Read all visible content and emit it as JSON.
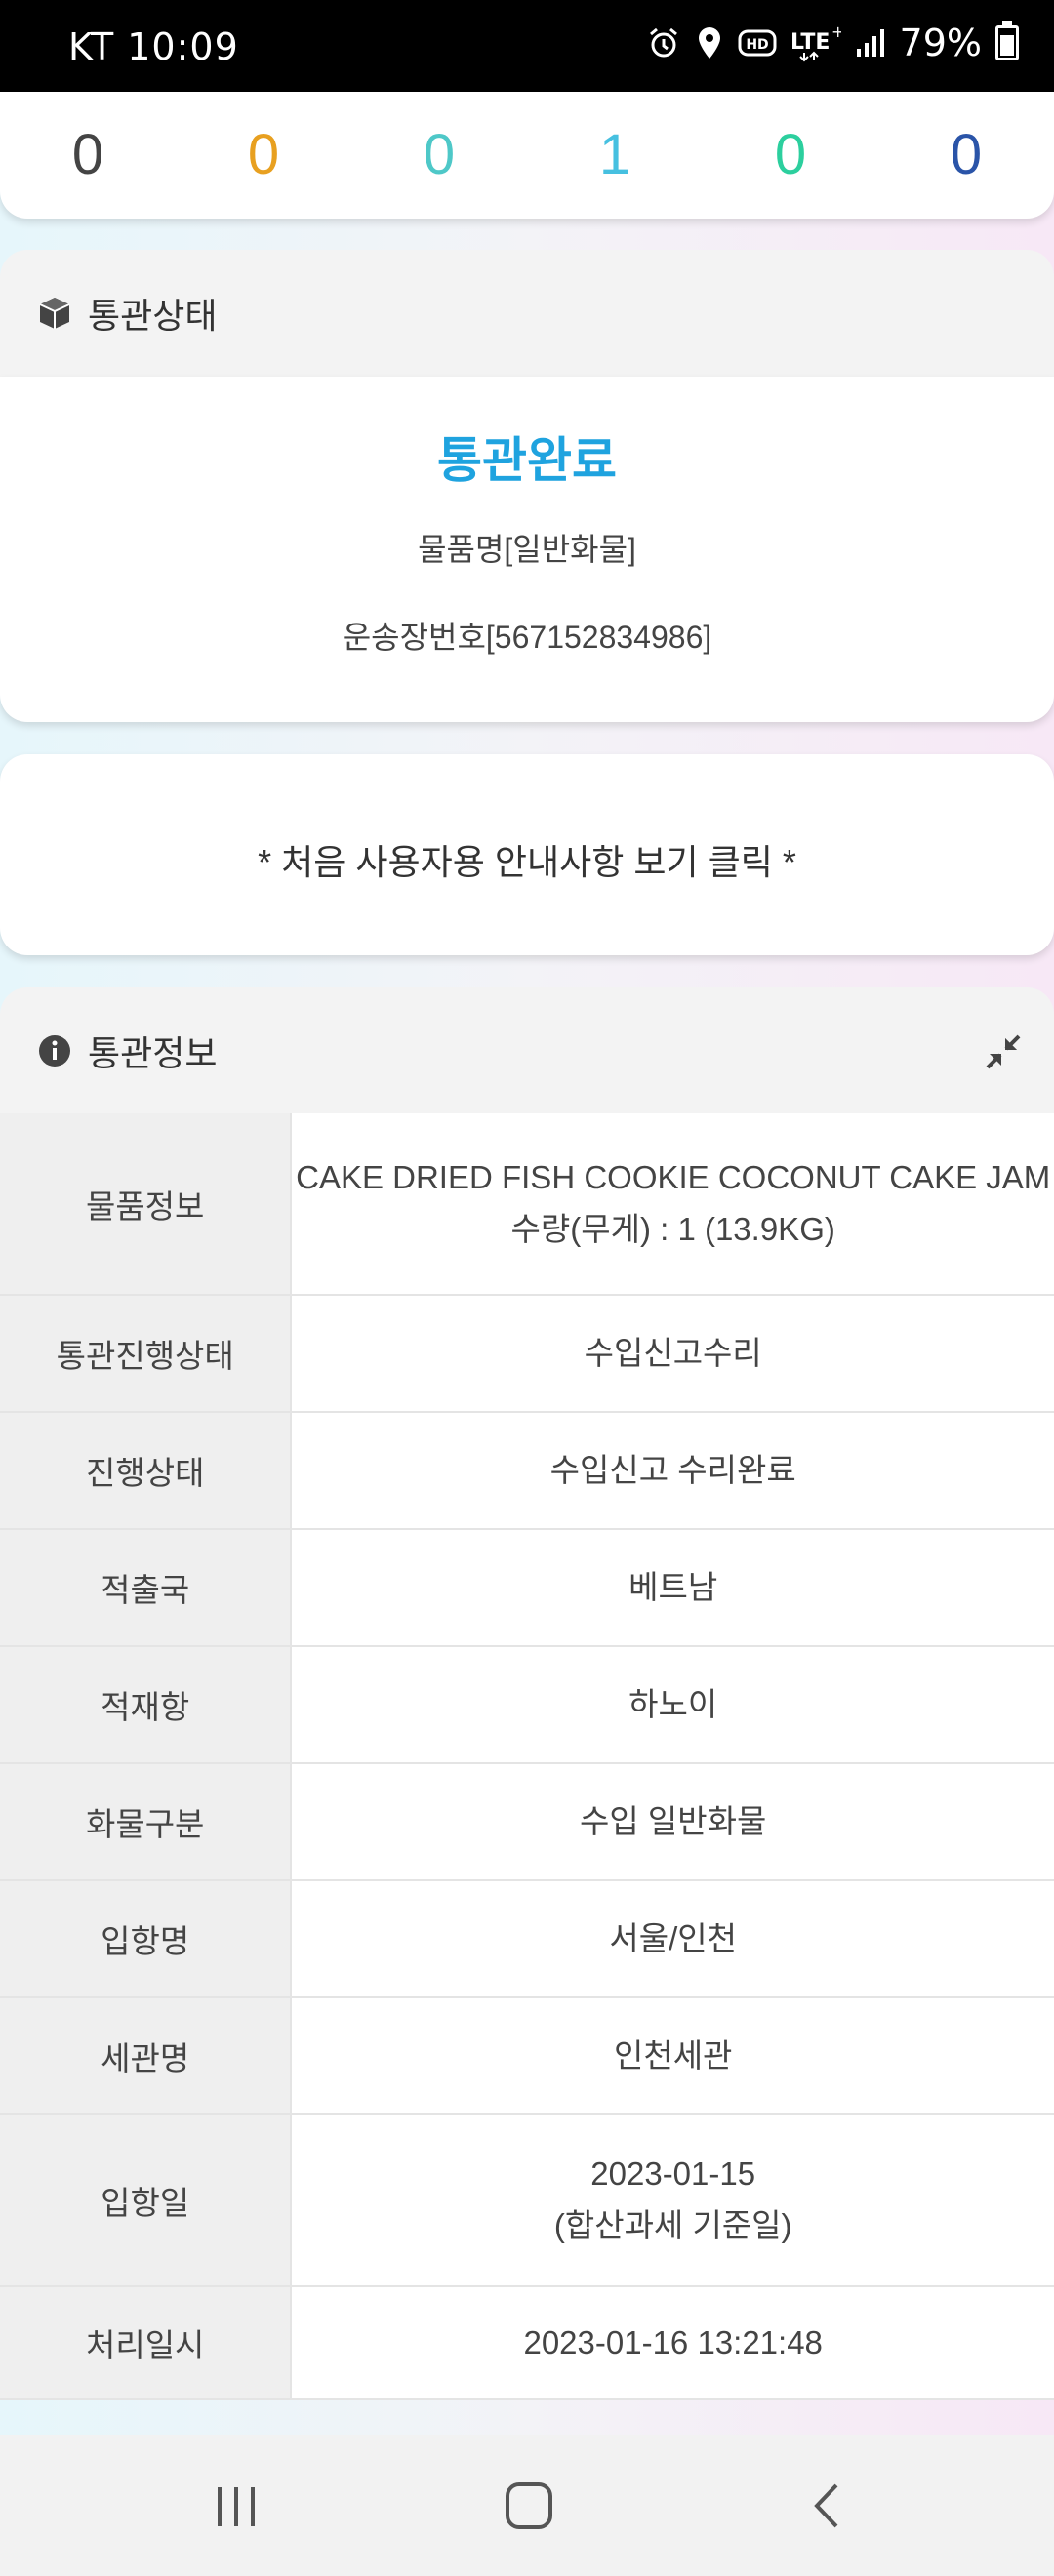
{
  "status_bar": {
    "carrier_time": "KT  10:09",
    "battery": "79%",
    "icons": [
      "alarm-icon",
      "location-icon",
      "hd-icon",
      "lte-icon",
      "signal-icon",
      "battery-icon"
    ]
  },
  "counters": [
    {
      "value": "0",
      "color": "#444444"
    },
    {
      "value": "0",
      "color": "#e8a020"
    },
    {
      "value": "0",
      "color": "#4ec8c8"
    },
    {
      "value": "1",
      "color": "#46c0e0"
    },
    {
      "value": "0",
      "color": "#2ccf9e"
    },
    {
      "value": "0",
      "color": "#2a54a8"
    }
  ],
  "customs_status": {
    "header": "통관상태",
    "header_icon": "box-icon",
    "main_status": "통관완료",
    "item_name": "물품명[일반화물]",
    "waybill": "운송장번호[567152834986]"
  },
  "guide": {
    "text": "* 처음 사용자용 안내사항 보기 클릭 *"
  },
  "customs_info": {
    "header": "통관정보",
    "header_icon": "info-icon",
    "collapse_icon": "collapse-icon",
    "rows": [
      {
        "label": "물품정보",
        "value": "CAKE DRIED FISH COOKIE COCONUT CAKE JAM",
        "value2": "수량(무게) : 1 (13.9KG)"
      },
      {
        "label": "통관진행상태",
        "value": "수입신고수리"
      },
      {
        "label": "진행상태",
        "value": "수입신고 수리완료"
      },
      {
        "label": "적출국",
        "value": "베트남"
      },
      {
        "label": "적재항",
        "value": "하노이"
      },
      {
        "label": "화물구분",
        "value": "수입 일반화물"
      },
      {
        "label": "입항명",
        "value": "서울/인천"
      },
      {
        "label": "세관명",
        "value": "인천세관"
      },
      {
        "label": "입항일",
        "value": "2023-01-15",
        "value2": "(합산과세 기준일)"
      },
      {
        "label": "처리일시",
        "value": "2023-01-16 13:21:48"
      }
    ]
  },
  "nav_bar": {
    "icons": [
      "recent-apps-icon",
      "home-icon",
      "back-icon"
    ]
  }
}
